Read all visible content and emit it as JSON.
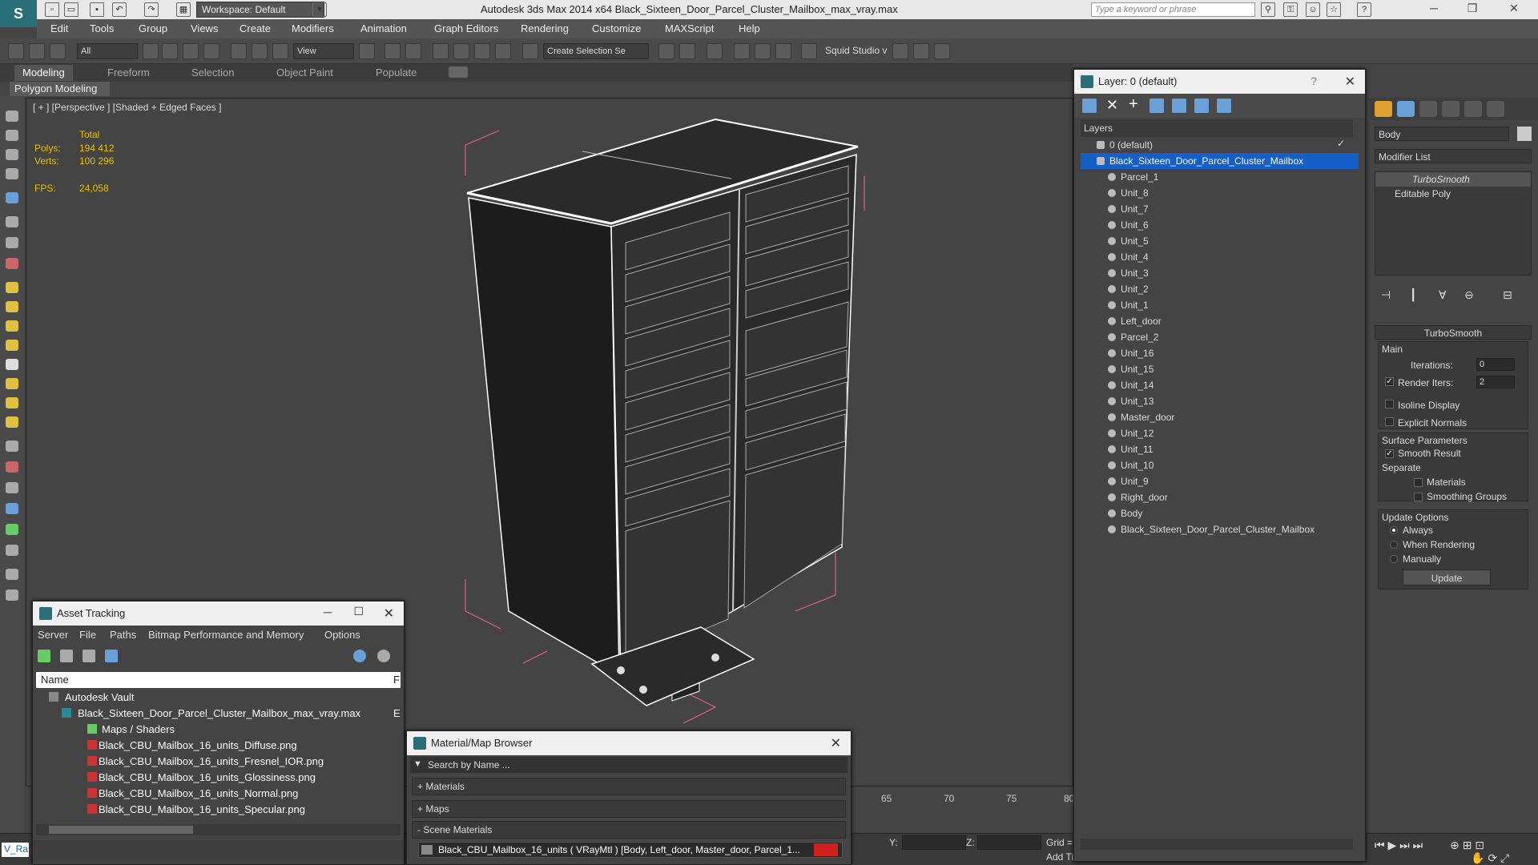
{
  "app": {
    "title": "Autodesk 3ds Max  2014 x64     Black_Sixteen_Door_Parcel_Cluster_Mailbox_max_vray.max",
    "workspace": "Workspace: Default",
    "search_placeholder": "Type a keyword or phrase"
  },
  "menu": [
    "Edit",
    "Tools",
    "Group",
    "Views",
    "Create",
    "Modifiers",
    "Animation",
    "Graph Editors",
    "Rendering",
    "Customize",
    "MAXScript",
    "Help"
  ],
  "toolbar": {
    "filter": "All",
    "ref_coord": "View",
    "selection_set": "Create Selection Se",
    "plugin_label": "Squid Studio v"
  },
  "ribbon": {
    "tabs": [
      "Modeling",
      "Freeform",
      "Selection",
      "Object Paint",
      "Populate"
    ],
    "panel_label": "Polygon Modeling"
  },
  "viewport": {
    "label": "[ + ] [Perspective ] [Shaded + Edged Faces ]",
    "stats_header": "Total",
    "polys_label": "Polys:",
    "polys": "194 412",
    "verts_label": "Verts:",
    "verts": "100 296",
    "fps_label": "FPS:",
    "fps": "24,058"
  },
  "timeline": {
    "ticks": [
      "65",
      "70",
      "75",
      "80"
    ],
    "y_label": "Y:",
    "z_label": "Z:",
    "grid_label": "Grid =",
    "add_time": "Add Ti"
  },
  "layer_window": {
    "title": "Layer: 0 (default)",
    "help": "?",
    "header": "Layers",
    "default_layer": "0 (default)",
    "selected_layer": "Black_Sixteen_Door_Parcel_Cluster_Mailbox",
    "items": [
      "Parcel_1",
      "Unit_8",
      "Unit_7",
      "Unit_6",
      "Unit_5",
      "Unit_4",
      "Unit_3",
      "Unit_2",
      "Unit_1",
      "Left_door",
      "Parcel_2",
      "Unit_16",
      "Unit_15",
      "Unit_14",
      "Unit_13",
      "Master_door",
      "Unit_12",
      "Unit_11",
      "Unit_10",
      "Unit_9",
      "Right_door",
      "Body",
      "Black_Sixteen_Door_Parcel_Cluster_Mailbox"
    ]
  },
  "command_panel": {
    "object_name": "Body",
    "modifier_list": "Modifier List",
    "stack": [
      "TurboSmooth",
      "Editable Poly"
    ],
    "rollout_title": "TurboSmooth",
    "main_label": "Main",
    "iterations_label": "Iterations:",
    "iterations": "0",
    "render_iters_label": "Render Iters:",
    "render_iters": "2",
    "isoline": "Isoline Display",
    "explicit_normals": "Explicit Normals",
    "surface_params": "Surface Parameters",
    "smooth_result": "Smooth Result",
    "separate": "Separate",
    "materials": "Materials",
    "smoothing_groups": "Smoothing Groups",
    "update_options": "Update Options",
    "always": "Always",
    "when_rendering": "When Rendering",
    "manually": "Manually",
    "update_button": "Update"
  },
  "asset_tracking": {
    "title": "Asset Tracking",
    "menu": [
      "Server",
      "File",
      "Paths",
      "Bitmap Performance and Memory",
      "Options"
    ],
    "col_name": "Name",
    "col_f": "F",
    "vault": "Autodesk Vault",
    "file": "Black_Sixteen_Door_Parcel_Cluster_Mailbox_max_vray.max",
    "file_status": "E",
    "maps_folder": "Maps / Shaders",
    "maps": [
      "Black_CBU_Mailbox_16_units_Diffuse.png",
      "Black_CBU_Mailbox_16_units_Fresnel_IOR.png",
      "Black_CBU_Mailbox_16_units_Glossiness.png",
      "Black_CBU_Mailbox_16_units_Normal.png",
      "Black_CBU_Mailbox_16_units_Specular.png"
    ],
    "status_text": "V_Ra"
  },
  "material_browser": {
    "title": "Material/Map Browser",
    "search_placeholder": "Search by Name ...",
    "sections": [
      "+ Materials",
      "+ Maps",
      "- Scene Materials"
    ],
    "scene_material": "Black_CBU_Mailbox_16_units  ( VRayMtl ) [Body, Left_door, Master_door, Parcel_1..."
  },
  "colors": {
    "selection": "#1560c8",
    "stat_text": "#e8c100",
    "bounding_box": "#e0608a"
  }
}
